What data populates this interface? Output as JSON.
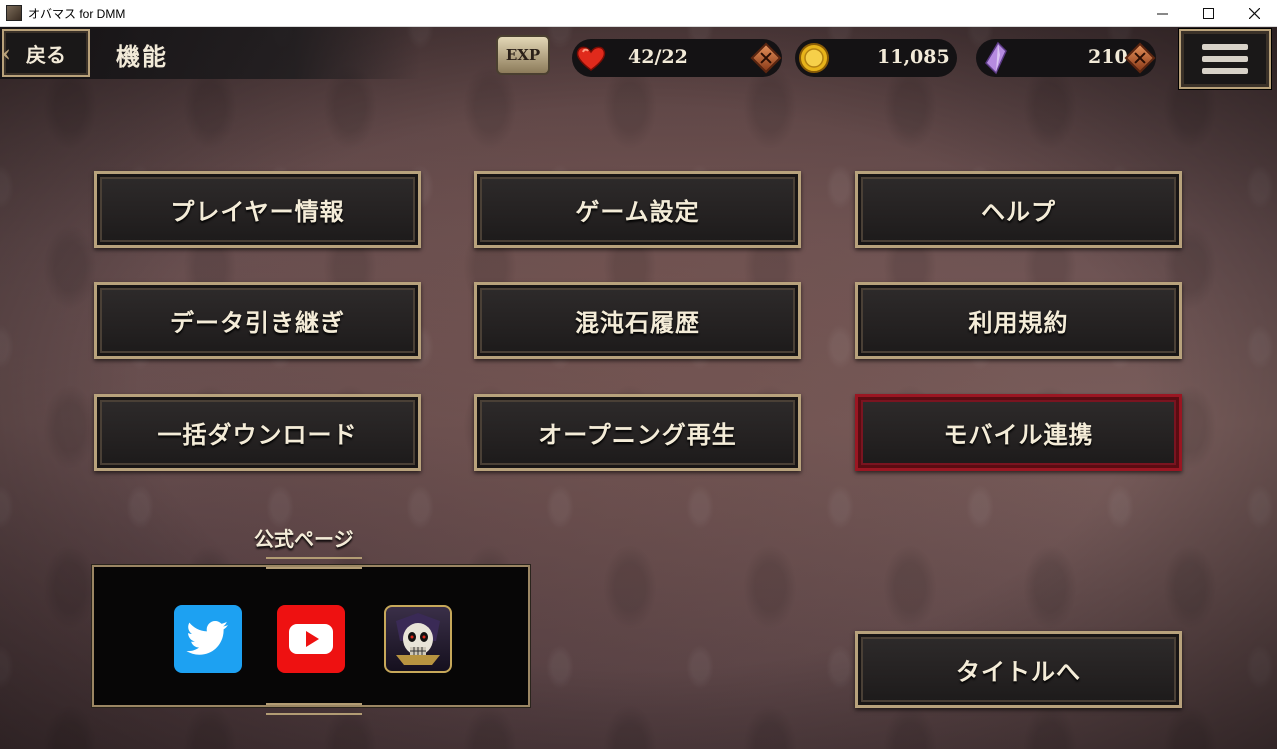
{
  "window": {
    "title": "オバマス for DMM",
    "minimize_glyph": "—",
    "close_glyph": "✕"
  },
  "header": {
    "back_label": "戻る",
    "title": "機能",
    "exp_label": "EXP",
    "stamina": "42/22",
    "gold": "11,085",
    "gems": "210"
  },
  "buttons": {
    "player_info": "プレイヤー情報",
    "game_settings": "ゲーム設定",
    "help": "ヘルプ",
    "data_transfer": "データ引き継ぎ",
    "chaos_stone_history": "混沌石履歴",
    "terms": "利用規約",
    "bulk_download": "一括ダウンロード",
    "opening_replay": "オープニング再生",
    "mobile_link": "モバイル連携",
    "to_title": "タイトルへ"
  },
  "official": {
    "label": "公式ページ"
  },
  "colors": {
    "button_border": "#b8a27c",
    "active_border": "#9a1622",
    "twitter": "#1da1f2",
    "youtube": "#ee1111"
  }
}
